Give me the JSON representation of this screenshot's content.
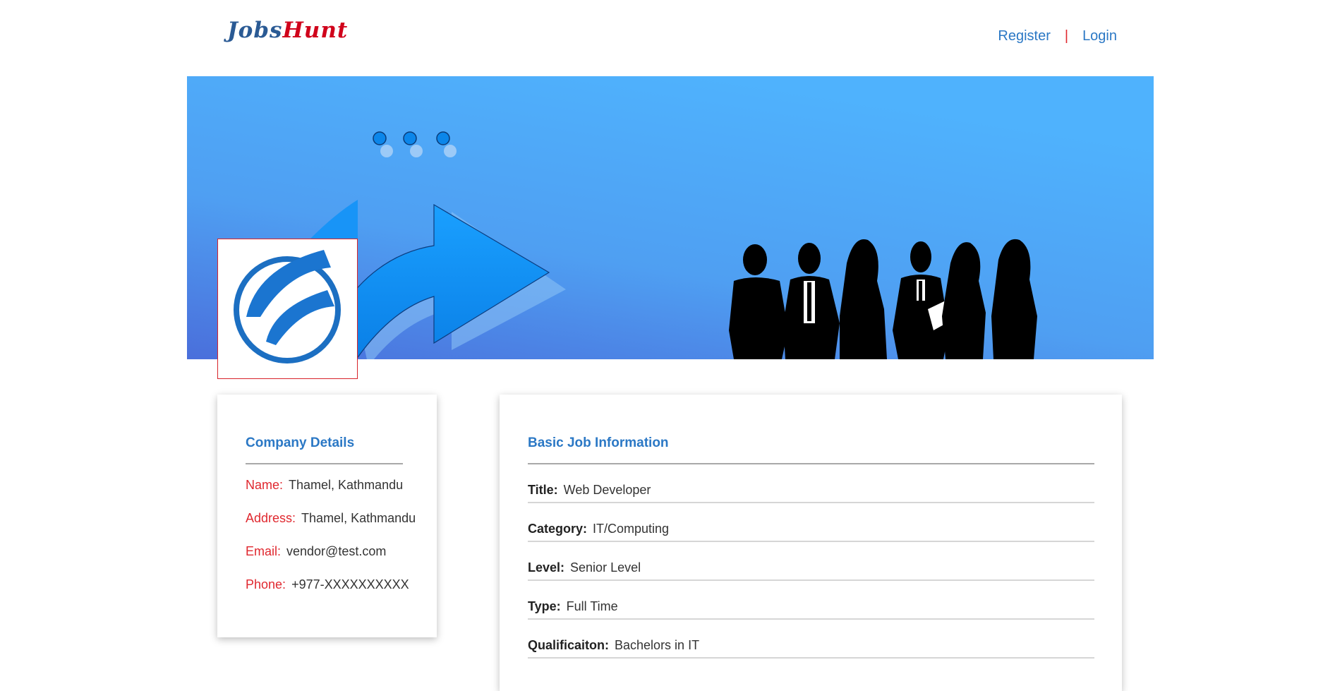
{
  "header": {
    "logo_part1": "Jobs",
    "logo_part2": "Hunt",
    "nav": {
      "register": "Register",
      "separator": "|",
      "login": "Login"
    }
  },
  "company": {
    "title": "Company Details",
    "fields": [
      {
        "label": "Name:",
        "value": "Thamel, Kathmandu"
      },
      {
        "label": "Address:",
        "value": "Thamel, Kathmandu"
      },
      {
        "label": "Email:",
        "value": "vendor@test.com"
      },
      {
        "label": "Phone:",
        "value": "+977-XXXXXXXXXX"
      }
    ]
  },
  "job": {
    "title": "Basic Job Information",
    "fields": [
      {
        "label": "Title:",
        "value": "Web Developer"
      },
      {
        "label": "Category:",
        "value": "IT/Computing"
      },
      {
        "label": "Level:",
        "value": "Senior Level"
      },
      {
        "label": "Type:",
        "value": "Full Time"
      },
      {
        "label": "Qualificaiton:",
        "value": "Bachelors in IT"
      }
    ]
  },
  "colors": {
    "accent_blue": "#2b78c5",
    "label_red": "#e0282f",
    "logo_dark_blue": "#2a5a94",
    "banner_light": "#4fb2fd",
    "banner_dark": "#4a6fdb"
  },
  "icons": {
    "banner": "business-people-arrow-banner",
    "company_logo": "company-swoosh-logo"
  }
}
